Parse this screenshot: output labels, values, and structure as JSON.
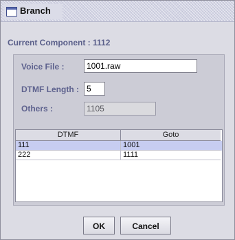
{
  "window": {
    "title": "Branch"
  },
  "current_component": "Current Component : 1112",
  "form": {
    "voice_file_label": "Voice File :",
    "voice_file_value": "1001.raw",
    "dtmf_length_label": "DTMF Length :",
    "dtmf_length_value": "5",
    "others_label": "Others :",
    "others_value": "1105"
  },
  "table": {
    "headers": [
      "DTMF",
      "Goto"
    ],
    "rows": [
      {
        "dtmf": "111",
        "goto": "1001"
      },
      {
        "dtmf": "222",
        "goto": "1111"
      }
    ]
  },
  "buttons": {
    "ok": "OK",
    "cancel": "Cancel"
  },
  "colors": {
    "title_bar": "#d2d3e3",
    "label": "#5e628e",
    "selected_row": "#c7cdf1"
  }
}
